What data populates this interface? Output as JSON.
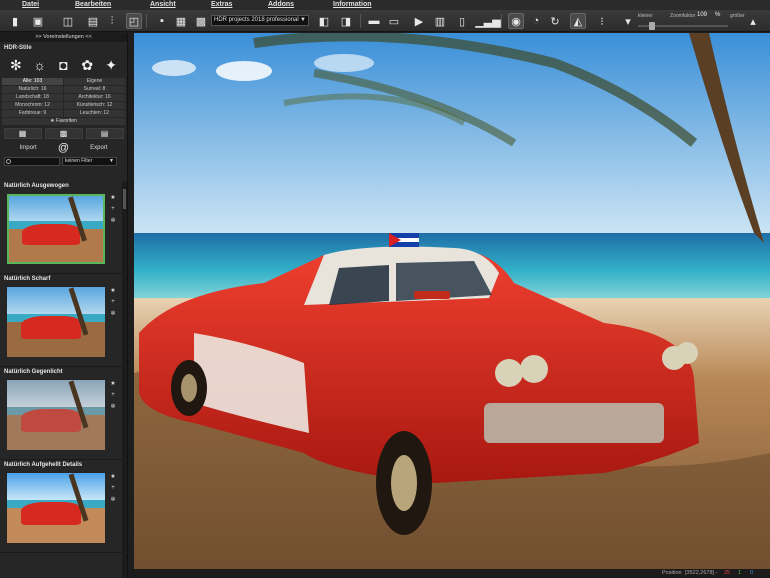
{
  "menu": {
    "items": [
      "Datei",
      "Bearbeiten",
      "Ansicht",
      "Extras",
      "Addons",
      "Information"
    ]
  },
  "toolbar": {
    "preset_select": "HDR projects 2018 professional",
    "zoom_small_label": "kleiner",
    "zoom_label": "Zoomfaktor",
    "zoom_value": "109",
    "zoom_unit": "%",
    "zoom_big_label": "größer",
    "zoom_slider_level": 0.15
  },
  "sidebar": {
    "header": ">> Voreinstellungen <<",
    "section_title": "HDR-Stile",
    "categories": [
      {
        "label": "Alle: 103",
        "selected": true
      },
      {
        "label": "Eigene",
        "selected": false
      },
      {
        "label": "Natürlich: 16",
        "selected": false
      },
      {
        "label": "Surreal: 8",
        "selected": false
      },
      {
        "label": "Landschaft: 18",
        "selected": false
      },
      {
        "label": "Architektur: 16",
        "selected": false
      },
      {
        "label": "Monochrom: 12",
        "selected": false
      },
      {
        "label": "Künstlerisch: 12",
        "selected": false
      },
      {
        "label": "Farbtreue: 9",
        "selected": false
      },
      {
        "label": "Leuchten: 12",
        "selected": false
      }
    ],
    "favorites": "★ Favoriten",
    "import_label": "Import",
    "export_label": "Export",
    "at_symbol": "@",
    "filter_value": "keinen Filter",
    "presets": [
      {
        "title": "Natürlich Ausgewogen",
        "selected": true
      },
      {
        "title": "Natürlich Scharf",
        "selected": false
      },
      {
        "title": "Natürlich Gegenlicht",
        "selected": false
      },
      {
        "title": "Natürlich Aufgehellt Details",
        "selected": false
      }
    ]
  },
  "status": {
    "position_label": "Position",
    "position_value": "[3522,2678] -",
    "red_value": "25",
    "green_value": "1",
    "blue_value": "0"
  },
  "colors": {
    "accent_selected": "#5bb65b",
    "car_red": "#d62a20"
  }
}
